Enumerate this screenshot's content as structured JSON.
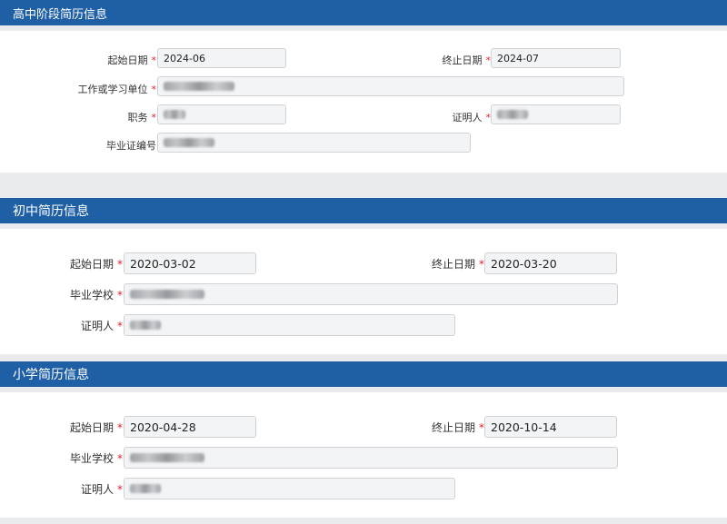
{
  "high": {
    "title": "高中阶段简历信息",
    "start_label": "起始日期",
    "start_value": "2024-06",
    "end_label": "终止日期",
    "end_value": "2024-07",
    "unit_label": "工作或学习单位",
    "position_label": "职务",
    "witness_label": "证明人",
    "cert_label": "毕业证编号",
    "required_mark": "*"
  },
  "middle": {
    "title": "初中简历信息",
    "start_label": "起始日期",
    "start_value": "2020-03-02",
    "end_label": "终止日期",
    "end_value": "2020-03-20",
    "school_label": "毕业学校",
    "witness_label": "证明人",
    "required_mark": "*"
  },
  "primary": {
    "title": "小学简历信息",
    "start_label": "起始日期",
    "start_value": "2020-04-28",
    "end_label": "终止日期",
    "end_value": "2020-10-14",
    "school_label": "毕业学校",
    "witness_label": "证明人",
    "required_mark": "*"
  },
  "colors": {
    "header": "#1f5fa5",
    "required": "#d23",
    "field_bg": "#f3f4f6"
  }
}
